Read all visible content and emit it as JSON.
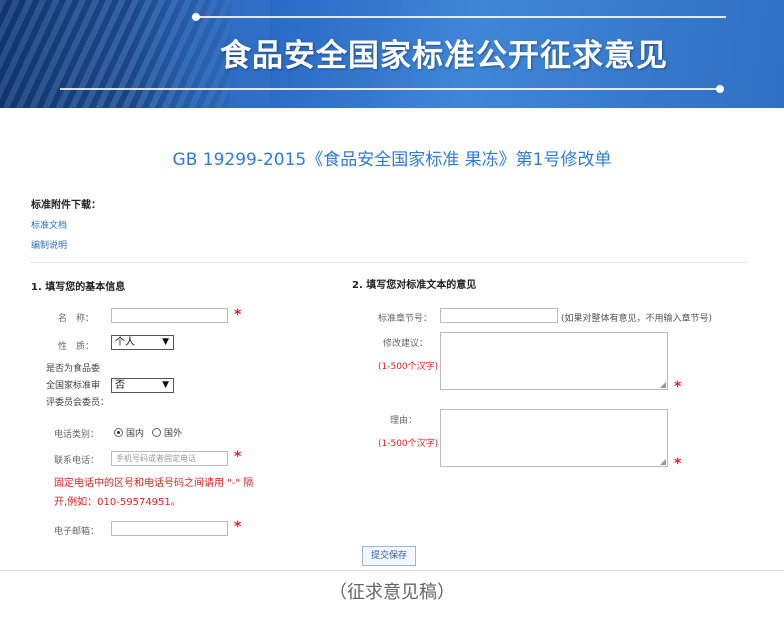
{
  "banner": {
    "title": "食品安全国家标准公开征求意见"
  },
  "document": {
    "title": "GB 19299-2015《食品安全国家标准 果冻》第1号修改单"
  },
  "attachments": {
    "heading": "标准附件下载：",
    "links": [
      "标准文档",
      "编制说明"
    ]
  },
  "section1": {
    "heading": "1. 填写您的基本信息",
    "name_label": "名　称：",
    "name_value": "",
    "nature_label": "性　质：",
    "nature_value": "个人",
    "committee_label": "是否为食品委全国家标准审评委员会委员：",
    "committee_lines": [
      "是否为食品委",
      "全国家标准审",
      "评委员会委员："
    ],
    "committee_value": "否",
    "phone_type_label": "电话类别：",
    "phone_type_options": [
      "国内",
      "国外"
    ],
    "phone_type_selected": "国内",
    "phone_label": "联系电话：",
    "phone_placeholder": "手机号码或者固定电话",
    "phone_note": "固定电话中的区号和电话号码之间请用 \"-\" 隔开,例如：010-59574951。",
    "phone_note_lines": [
      "固定电话中的区号和电话号码之间请用 \"-\" 隔",
      "开,例如：010-59574951。"
    ],
    "email_label": "电子邮箱：",
    "email_value": ""
  },
  "section2": {
    "heading": "2. 填写您对标准文本的意见",
    "chapter_label": "标准章节号：",
    "chapter_value": "",
    "chapter_hint": "(如果对整体有意见，不用输入章节号)",
    "suggestion_label": "修改建议：",
    "suggestion_limit": "(1-500个汉字)",
    "reason_label": "理由：",
    "reason_limit": "(1-500个汉字)"
  },
  "submit_label": "提交保存",
  "caption": "（征求意见稿）",
  "colors": {
    "banner_blue": "#2a6bc4",
    "title_blue": "#2e7cd6",
    "required_red": "#e02020"
  }
}
